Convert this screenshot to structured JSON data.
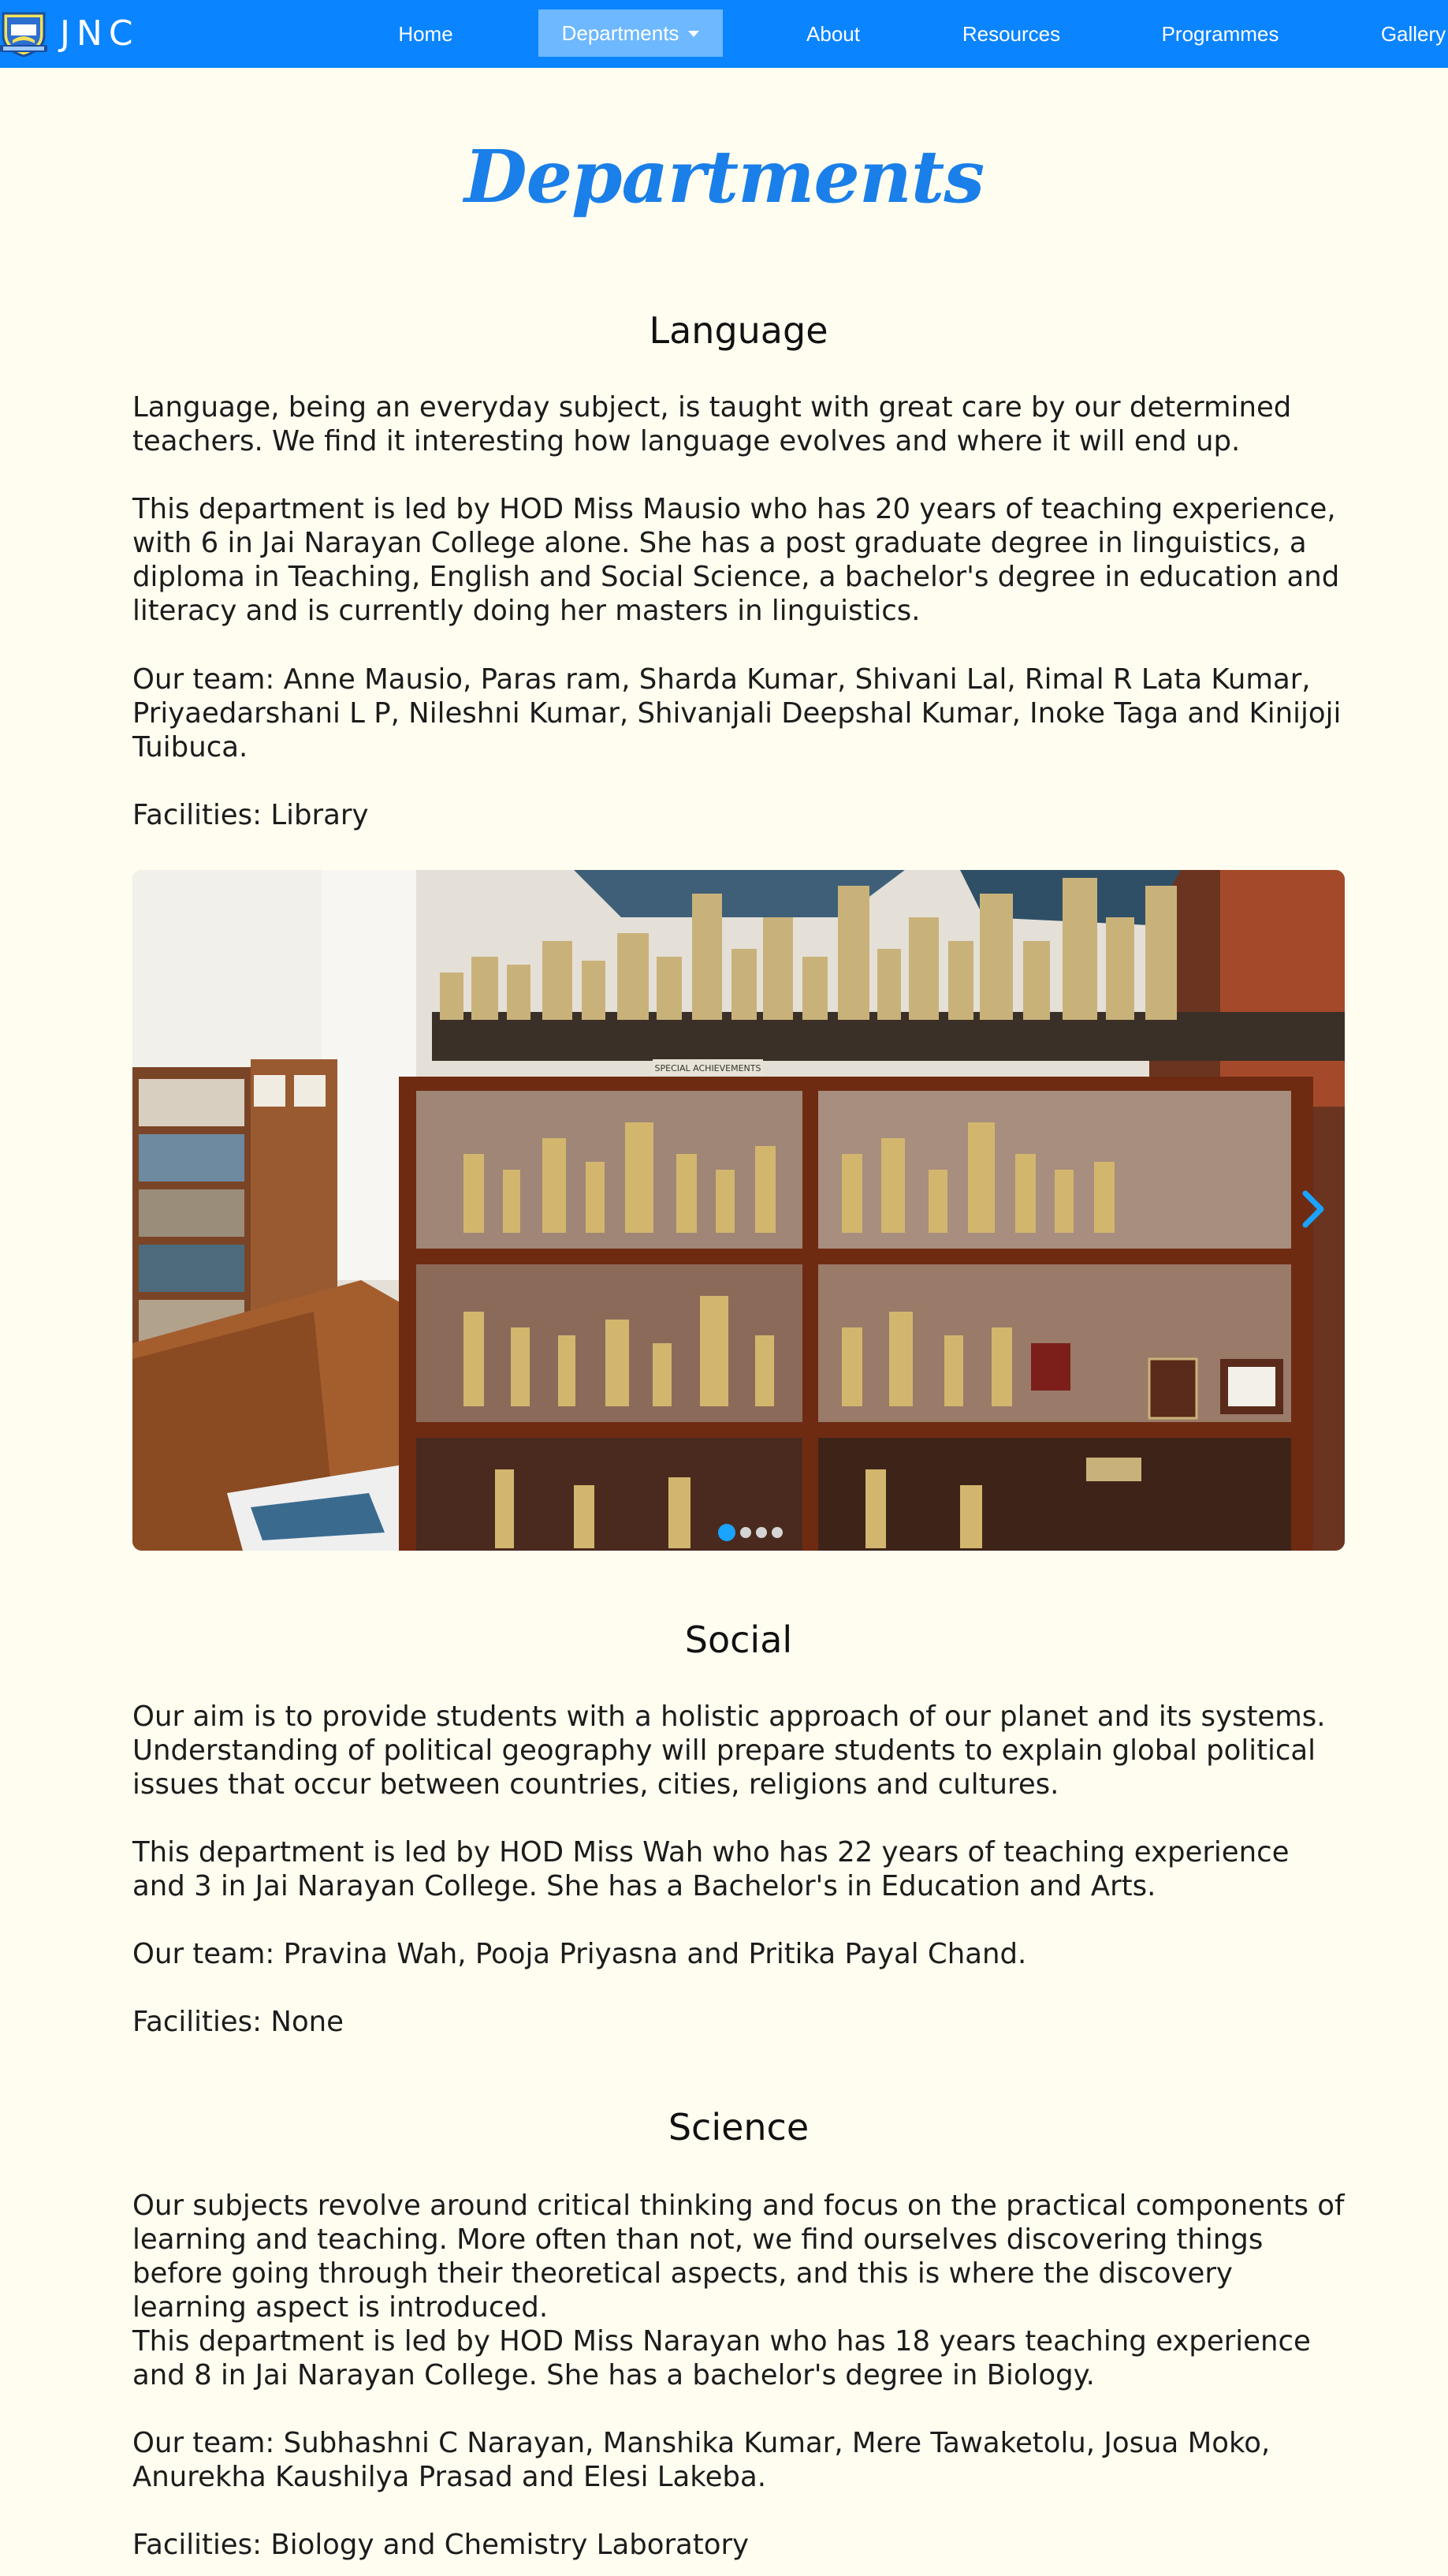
{
  "navbar": {
    "brand": "JNC",
    "items": [
      {
        "label": "Home"
      },
      {
        "label": "Departments"
      },
      {
        "label": "About"
      },
      {
        "label": "Resources"
      },
      {
        "label": "Programmes"
      },
      {
        "label": "Gallery"
      }
    ],
    "active_item": "Departments",
    "colors": {
      "bar": "#0a84ff",
      "active": "#6db8ff"
    }
  },
  "page": {
    "title": "Departments",
    "accent_color": "#1a7fe8",
    "background": "#fffdf0"
  },
  "sections": {
    "language": {
      "heading": "Language",
      "paragraphs": [
        "Language, being an everyday subject, is taught with great care by our determined teachers. We find it interesting how language evolves and where it will end up.",
        "This department is led by HOD Miss Mausio who has 20 years of teaching experience, with 6 in Jai Narayan College alone. She has a post graduate degree in linguistics, a diploma in Teaching, English and Social Science, a bachelor's degree in education and literacy and is currently doing her masters in linguistics.",
        "Our team: Anne Mausio, Paras ram, Sharda Kumar, Shivani Lal, Rimal R Lata Kumar, Priyaedarshani L P, Nileshni Kumar, Shivanjali Deepshal Kumar, Inoke Taga and Kinijoji Tuibuca.",
        "Facilities: Library"
      ],
      "carousel": {
        "slide_count": 4,
        "active_slide": 1,
        "trophy_sign": "SPECIAL ACHIEVEMENTS"
      }
    },
    "social": {
      "heading": "Social",
      "paragraphs": [
        "Our aim is to provide students with a holistic approach of our planet and its systems. Understanding of political geography will prepare students to explain global political issues that occur between countries, cities, religions and cultures.",
        "This department is led by HOD Miss Wah who has 22 years of teaching experience and 3 in Jai Narayan College. She has a Bachelor's in Education and Arts.",
        "Our team: Pravina Wah, Pooja Priyasna and Pritika Payal Chand.",
        "Facilities: None"
      ]
    },
    "science": {
      "heading": "Science",
      "paragraphs": [
        "Our subjects revolve around critical thinking and focus on the practical components of learning and teaching. More often than not, we find ourselves discovering things before going through their theoretical aspects, and this is where the discovery learning aspect is introduced.",
        "This department is led by HOD Miss Narayan who has 18 years teaching experience and 8 in Jai Narayan College. She has a bachelor's degree in Biology.",
        "Our team: Subhashni C Narayan, Manshika Kumar, Mere Tawaketolu, Josua Moko, Anurekha Kaushilya Prasad and Elesi Lakeba.",
        "Facilities: Biology and Chemistry Laboratory"
      ]
    }
  }
}
